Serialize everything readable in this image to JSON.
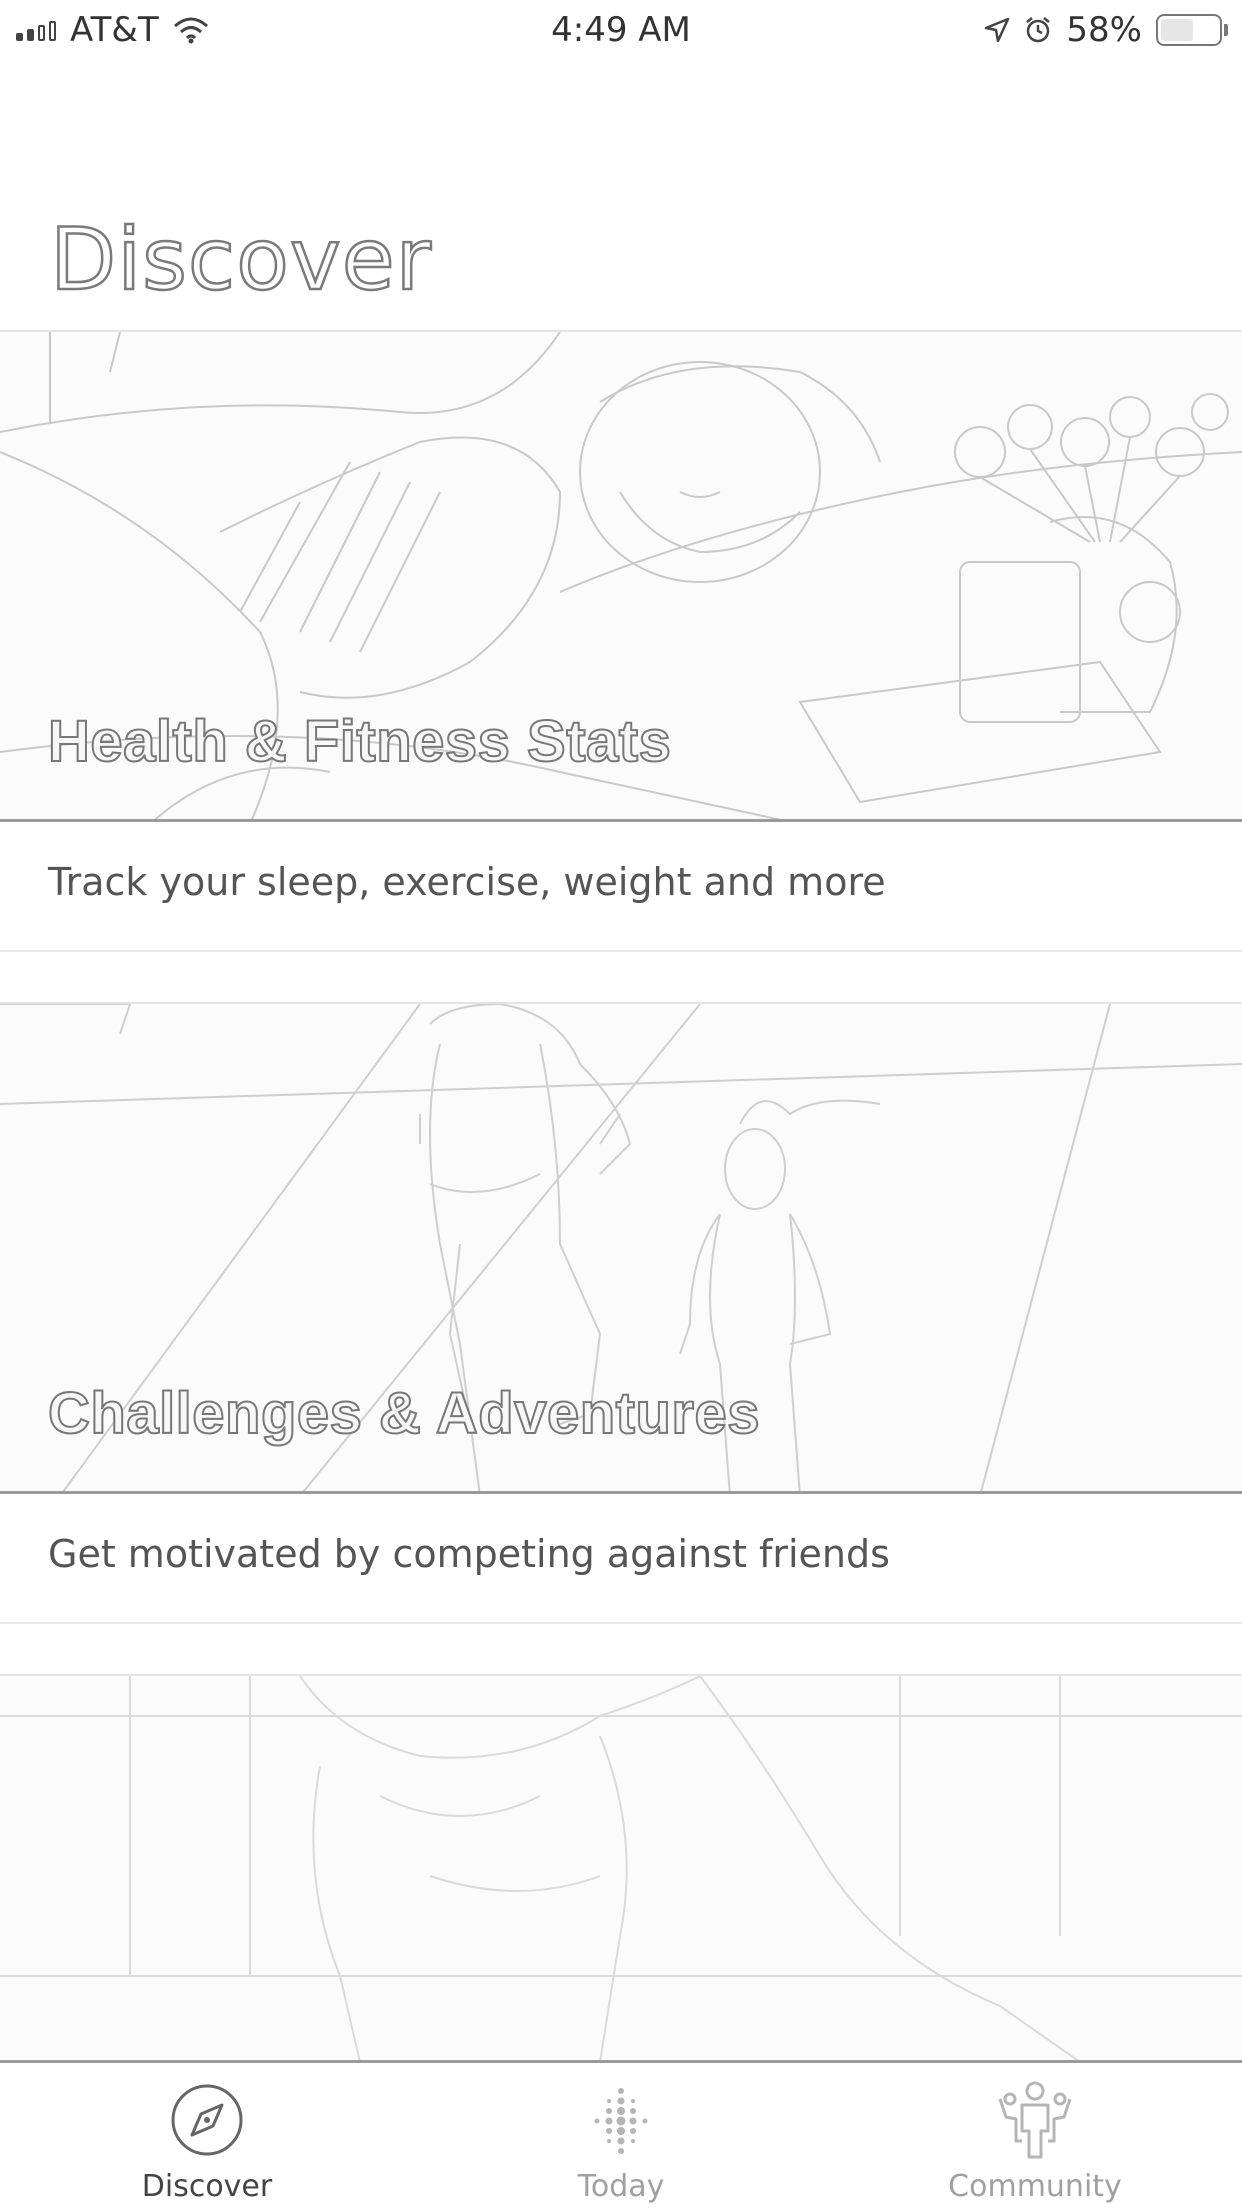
{
  "status_bar": {
    "carrier": "AT&T",
    "time": "4:49 AM",
    "battery": "58%",
    "battery_level": 0.58,
    "icons": [
      "signal-icon",
      "wifi-icon",
      "location-icon",
      "alarm-icon",
      "battery-icon"
    ]
  },
  "page": {
    "title": "Discover"
  },
  "cards": [
    {
      "title": "Health & Fitness Stats",
      "description": "Track your sleep, exercise, weight and more"
    },
    {
      "title": "Challenges & Adventures",
      "description": "Get motivated by competing against friends"
    },
    {
      "title": "",
      "description": ""
    }
  ],
  "tabs": [
    {
      "label": "Discover",
      "icon": "compass-icon",
      "active": true
    },
    {
      "label": "Today",
      "icon": "dots-icon",
      "active": false
    },
    {
      "label": "Community",
      "icon": "people-icon",
      "active": false
    }
  ],
  "colors": {
    "outline": "#7a7a7a",
    "background": "#ffffff",
    "active_tab": "#444444",
    "inactive_tab": "#a0a0a0"
  }
}
